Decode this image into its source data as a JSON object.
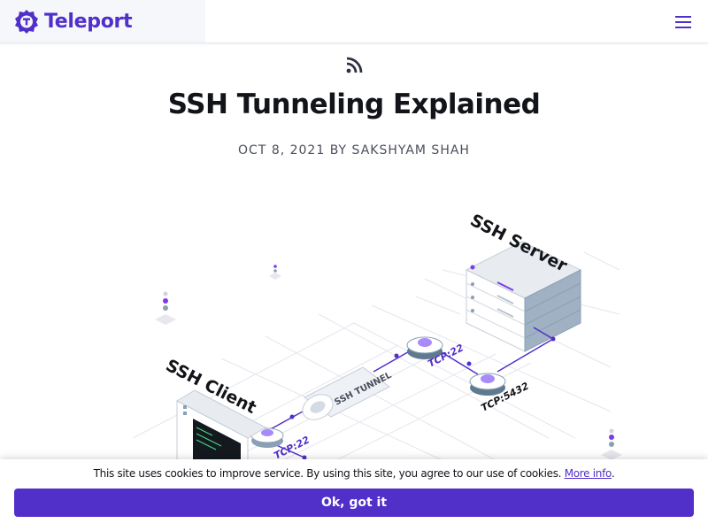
{
  "header": {
    "brand": "Teleport",
    "logo_icon": "teleport-logo-icon",
    "menu_icon": "hamburger-menu-icon",
    "accent_color": "#512fc9"
  },
  "article": {
    "rss_icon": "rss-icon",
    "title": "SSH Tunneling Explained",
    "date": "OCT 8, 2021",
    "by": "BY",
    "author": "SAKSHYAM SHAH"
  },
  "hero": {
    "server_label": "SSH Server",
    "client_label": "SSH Client",
    "tunnel_label": "SSH TUNNEL",
    "port_server": "TCP:22",
    "port_db": "TCP:5432",
    "port_client": "TCP:22"
  },
  "cookie_banner": {
    "text": "This site uses cookies to improve service. By using this site, you agree to our use of cookies.",
    "link": "More info",
    "suffix": ".",
    "button": "Ok, got it"
  }
}
